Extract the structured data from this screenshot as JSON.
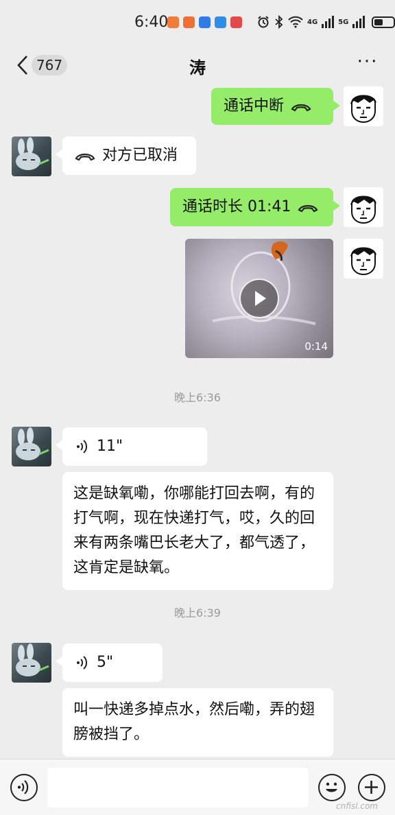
{
  "status_bar": {
    "time": "6:40",
    "app_icon_colors": [
      "#f07c3a",
      "#f06f35",
      "#2f7ce8",
      "#2e8de6",
      "#e04a4a"
    ],
    "net_4g": "4G",
    "net_5g": "5G",
    "battery_level": 0.45
  },
  "header": {
    "unread_count": "767",
    "title": "涛",
    "more_label": "···"
  },
  "messages": {
    "m1": {
      "text": "通话中断"
    },
    "m2": {
      "text": "对方已取消"
    },
    "m3": {
      "text": "通话时长 01:41"
    },
    "m4": {
      "duration": "0:14"
    },
    "ts1": "晚上6:36",
    "m5": {
      "duration": "11\""
    },
    "m6": {
      "text": "这是缺氧嘞，你哪能打回去啊，有的打气啊，现在快递打气，哎，久的回来有两条嘴巴长老大了，都气透了，这肯定是缺氧。"
    },
    "ts2": "晚上6:39",
    "m7": {
      "duration": "5\""
    },
    "m8": {
      "text": "叫一快递多掉点水，然后嘞，弄的翅膀被挡了。"
    }
  },
  "input_bar": {
    "input_value": ""
  },
  "watermark": "cnfisl.com",
  "colors": {
    "self_bubble": "#95ec69",
    "peer_bubble": "#ffffff",
    "background": "#ededed"
  }
}
